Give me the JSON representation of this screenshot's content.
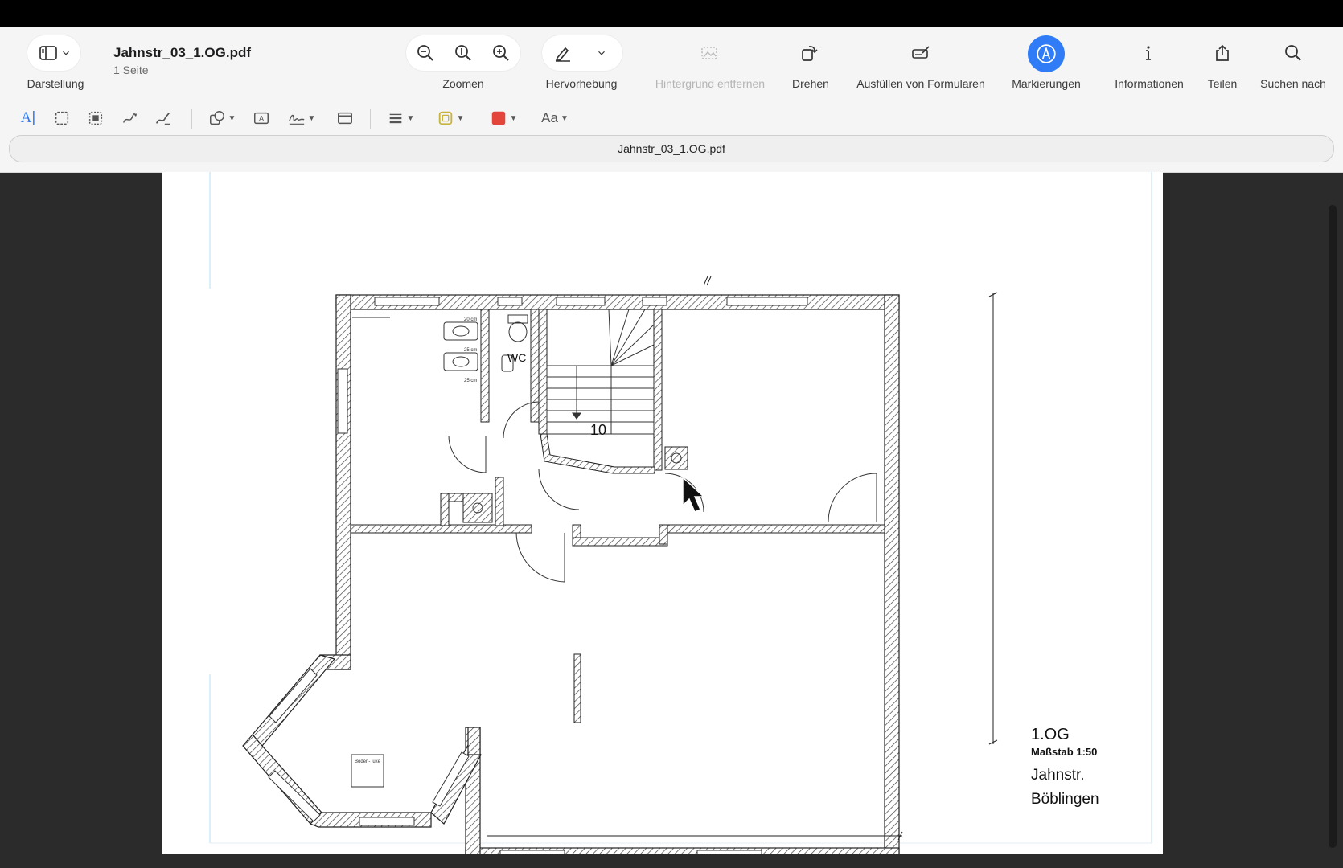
{
  "toolbar": {
    "view_label": "Darstellung",
    "doc_title": "Jahnstr_03_1.OG.pdf",
    "doc_pages": "1 Seite",
    "zoom_label": "Zoomen",
    "highlight_label": "Hervorhebung",
    "remove_bg_label": "Hintergrund entfernen",
    "rotate_label": "Drehen",
    "fill_forms_label": "Ausfüllen von Formularen",
    "markup_label": "Markierungen",
    "info_label": "Informationen",
    "share_label": "Teilen",
    "search_label": "Suchen nach"
  },
  "markup_tools": {
    "text_tool_glyph": "A",
    "font_label": "Aa",
    "border_color": "#c9b33a",
    "fill_color": "#e3453a"
  },
  "tab": {
    "title": "Jahnstr_03_1.OG.pdf"
  },
  "plan": {
    "room_wc": "WC",
    "stair_steps": "10",
    "dim_20": "20 cm",
    "dim_25a": "25 cm",
    "dim_25b": "25 cm",
    "hatch_label": "Boden-\nluke",
    "floor": "1.OG",
    "scale": "Maßstab 1:50",
    "street": "Jahnstr. ",
    "city": "Böblingen"
  },
  "colors": {
    "accent": "#2f7cf6",
    "toolbar_bg": "#f5f5f5",
    "page_bg": "#2b2b2b"
  }
}
